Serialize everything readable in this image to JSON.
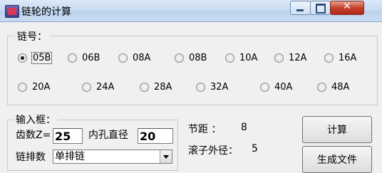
{
  "window": {
    "title": "链轮的计算",
    "close_glyph": "✕"
  },
  "chain_group": {
    "legend": "链号：",
    "options": [
      "05B",
      "06B",
      "08A",
      "08B",
      "10A",
      "12A",
      "16A",
      "20A",
      "24A",
      "28A",
      "32A",
      "40A",
      "48A"
    ],
    "selected": "05B"
  },
  "input_group": {
    "legend": "输入框：",
    "teeth_label": "齿数Z=",
    "teeth_value": "25",
    "bore_label": "内孔直径",
    "bore_value": "20",
    "rows_label": "链排数",
    "rows_value": "单排链"
  },
  "results": {
    "pitch_label": "节距  ：",
    "pitch_value": "8",
    "roller_label": "滚子外径：",
    "roller_value": "5"
  },
  "buttons": {
    "calculate": "计算",
    "generate": "生成文件"
  },
  "icons": {
    "app": "app-icon",
    "minimize": "minimize-icon",
    "maximize": "maximize-icon",
    "close": "close-icon",
    "dropdown": "chevron-down-icon"
  }
}
